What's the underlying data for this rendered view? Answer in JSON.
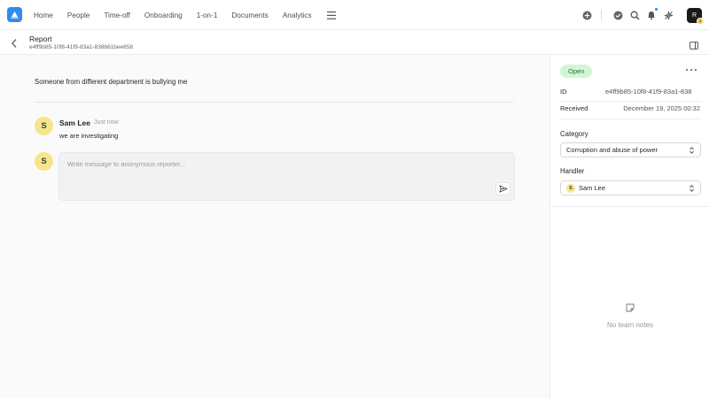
{
  "app": {
    "brand_color": "#2e8bef"
  },
  "nav": {
    "items": [
      {
        "label": "Home"
      },
      {
        "label": "People"
      },
      {
        "label": "Time-off"
      },
      {
        "label": "Onboarding"
      },
      {
        "label": "1-on-1"
      },
      {
        "label": "Documents"
      },
      {
        "label": "Analytics"
      }
    ],
    "icons": [
      "plus-circle-icon",
      "check-circle-icon",
      "search-icon",
      "bell-icon",
      "sparkle-icon"
    ],
    "user_avatar": {
      "initials": "R",
      "badge": "1"
    }
  },
  "header": {
    "title": "Report",
    "report_id": "e4ff9b85-10f8-41f9-83a1-838b61bee658"
  },
  "report": {
    "text": "Someone from different department is bullying me"
  },
  "messages": [
    {
      "avatar": "S",
      "author": "Sam Lee",
      "time": "Just now",
      "body": "we are investigating"
    }
  ],
  "composer": {
    "avatar": "S",
    "placeholder": "Write message to anonymous reporter..."
  },
  "panel": {
    "status": "Open",
    "status_color": "#d3f5d6",
    "id_label": "ID",
    "id_value": "e4ff9b85-10f8-41f9-83a1-838",
    "received_label": "Received",
    "received_value": "December 19, 2025 00:32",
    "category_label": "Category",
    "category_value": "Corruption and abuse of power",
    "handler_label": "Handler",
    "handler_avatar": "S",
    "handler_value": "Sam Lee",
    "notes_empty": "No team notes"
  }
}
